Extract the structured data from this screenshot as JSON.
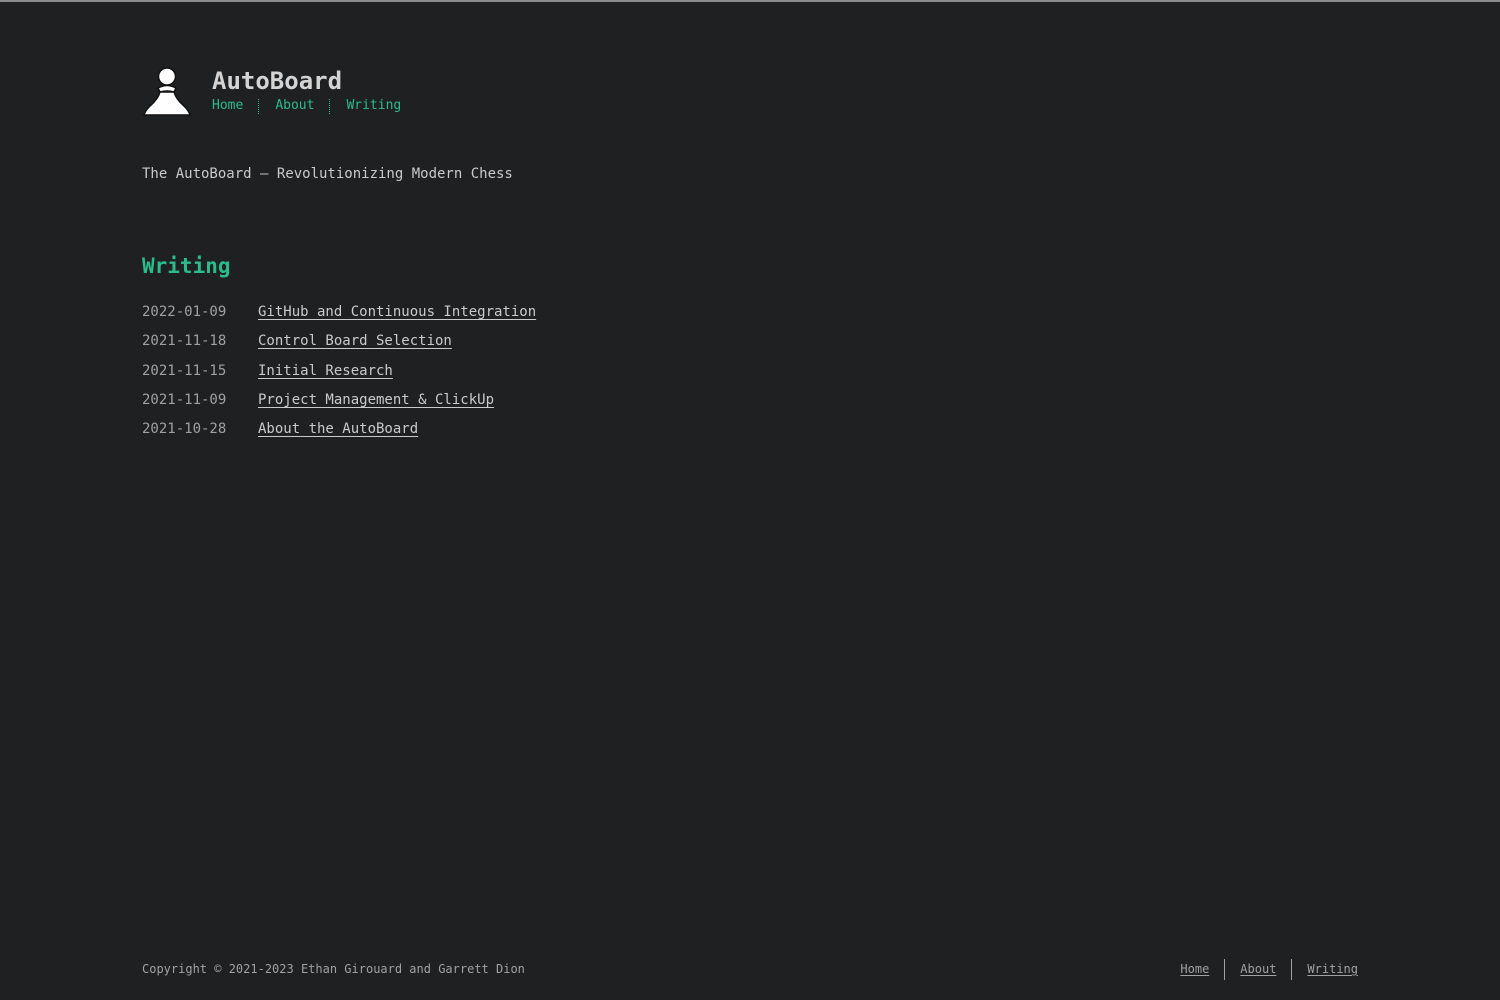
{
  "header": {
    "logo_icon": "chess-pawn-icon",
    "site_title": "AutoBoard",
    "nav": [
      "Home",
      "About",
      "Writing"
    ]
  },
  "tagline": "The AutoBoard – Revolutionizing Modern Chess",
  "writing": {
    "title": "Writing",
    "posts": [
      {
        "date": "2022-01-09",
        "title": "GitHub and Continuous Integration"
      },
      {
        "date": "2021-11-18",
        "title": "Control Board Selection"
      },
      {
        "date": "2021-11-15",
        "title": "Initial Research"
      },
      {
        "date": "2021-11-09",
        "title": "Project Management & ClickUp"
      },
      {
        "date": "2021-10-28",
        "title": "About the AutoBoard"
      }
    ]
  },
  "footer": {
    "copyright": "Copyright © 2021-2023 Ethan Girouard and Garrett Dion",
    "nav": [
      "Home",
      "About",
      "Writing"
    ]
  },
  "colors": {
    "background": "#1f2022",
    "accent": "#2bbc8a",
    "text": "#c9cacc",
    "muted": "#a0a1a3"
  }
}
